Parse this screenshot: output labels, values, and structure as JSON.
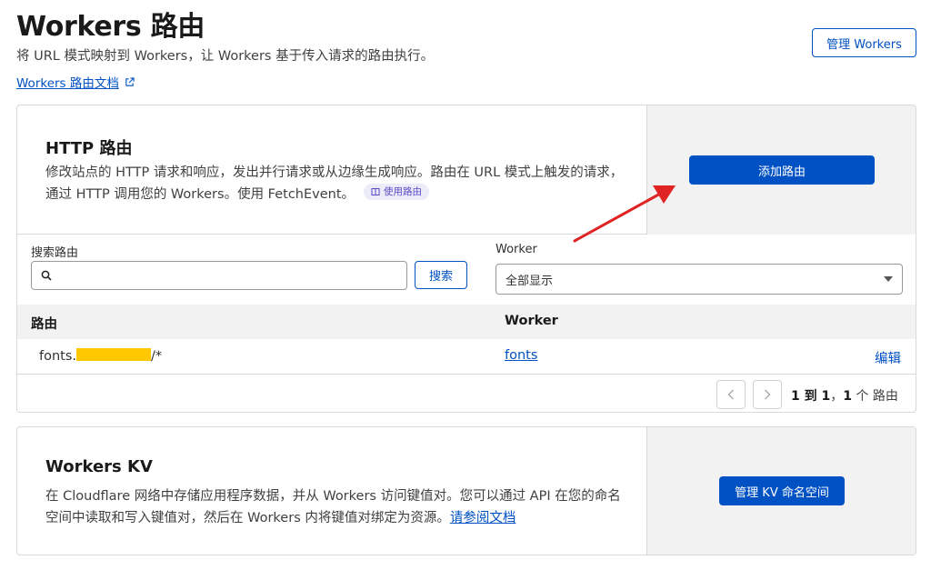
{
  "header": {
    "title": "Workers 路由",
    "subtitle": "将 URL 模式映射到 Workers，让 Workers 基于传入请求的路由执行。",
    "doc_link": "Workers 路由文档",
    "manage_button": "管理 Workers"
  },
  "http_routes": {
    "title": "HTTP 路由",
    "description": "修改站点的 HTTP 请求和响应，发出并行请求或从边缘生成响应。路由在 URL 模式上触发的请求，通过 HTTP 调用您的 Workers。使用 FetchEvent。",
    "badge": "使用路由",
    "add_button": "添加路由",
    "search_label": "搜索路由",
    "search_placeholder": "",
    "search_button": "搜索",
    "worker_filter_label": "Worker",
    "worker_filter_value": "全部显示",
    "columns": {
      "route": "路由",
      "worker": "Worker"
    },
    "rows": [
      {
        "route_prefix": "fonts.",
        "route_suffix": "/*",
        "worker": "fonts",
        "action": "编辑"
      }
    ],
    "pagination": {
      "range": "1 到 1",
      "separator": "，",
      "count": "1",
      "unit": " 个 路由"
    }
  },
  "kv": {
    "title": "Workers KV",
    "description": "在 Cloudflare 网络中存储应用程序数据，并从 Workers 访问键值对。您可以通过 API 在您的命名空间中读取和写入键值对，然后在 Workers 内将键值对绑定为资源。",
    "doc_link": "请参阅文档",
    "manage_button": "管理 KV 命名空间"
  },
  "colors": {
    "accent": "#0051c3",
    "annotation_arrow": "#e02424",
    "redaction": "#ffc800"
  }
}
